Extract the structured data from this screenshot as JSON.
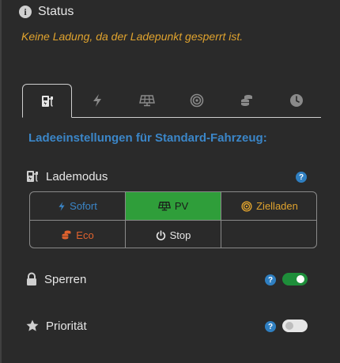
{
  "status": {
    "title": "Status",
    "info_icon_glyph": "i",
    "message": "Keine Ladung, da der Ladepunkt gesperrt ist.",
    "message_color": "#e0a32e"
  },
  "tabs": [
    {
      "icon": "charging-station-icon",
      "active": true
    },
    {
      "icon": "lightning-bolt-icon",
      "active": false
    },
    {
      "icon": "solar-panel-icon",
      "active": false
    },
    {
      "icon": "target-icon",
      "active": false
    },
    {
      "icon": "coins-icon",
      "active": false
    },
    {
      "icon": "clock-icon",
      "active": false
    }
  ],
  "heading": "Ladeeinstellungen für Standard-Fahrzeug:",
  "lademodus": {
    "label": "Lademodus",
    "help_glyph": "?",
    "selected": "PV",
    "buttons": {
      "sofort": {
        "label": "Sofort",
        "color": "#3b86c8"
      },
      "pv": {
        "label": "PV",
        "color": "#1a1a1a"
      },
      "zielladen": {
        "label": "Zielladen",
        "color": "#e0a32e"
      },
      "eco": {
        "label": "Eco",
        "color": "#e0622e"
      },
      "stop": {
        "label": "Stop",
        "color": "#e6e6e6"
      }
    }
  },
  "sperren": {
    "label": "Sperren",
    "help_glyph": "?",
    "enabled": true
  },
  "prioritaet": {
    "label": "Priorität",
    "help_glyph": "?",
    "enabled": false
  },
  "colors": {
    "accent": "#3b86c8",
    "active_green": "#2f9e3a",
    "toggle_on": "#1e8e3a",
    "background": "#2a2a2a"
  }
}
